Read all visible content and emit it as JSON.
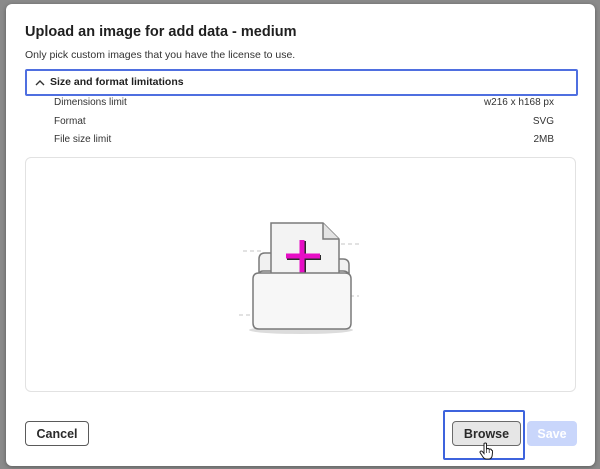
{
  "dialog": {
    "title": "Upload an image for add data - medium",
    "subtitle": "Only pick custom images that you have the license to use."
  },
  "limitations": {
    "header_label": "Size and format limitations",
    "expanded": true,
    "rows": [
      {
        "label": "Dimensions limit",
        "value": "w216 x h168 px"
      },
      {
        "label": "Format",
        "value": "SVG"
      },
      {
        "label": "File size limit",
        "value": "2MB"
      }
    ]
  },
  "dropzone": {
    "icon": "folder-add-file-icon",
    "accent_color": "#e60ec5"
  },
  "footer": {
    "cancel_label": "Cancel",
    "browse_label": "Browse",
    "save_label": "Save",
    "save_enabled": false
  },
  "colors": {
    "focus": "#3d63dd",
    "primary_disabled": "#c9d6fb"
  }
}
